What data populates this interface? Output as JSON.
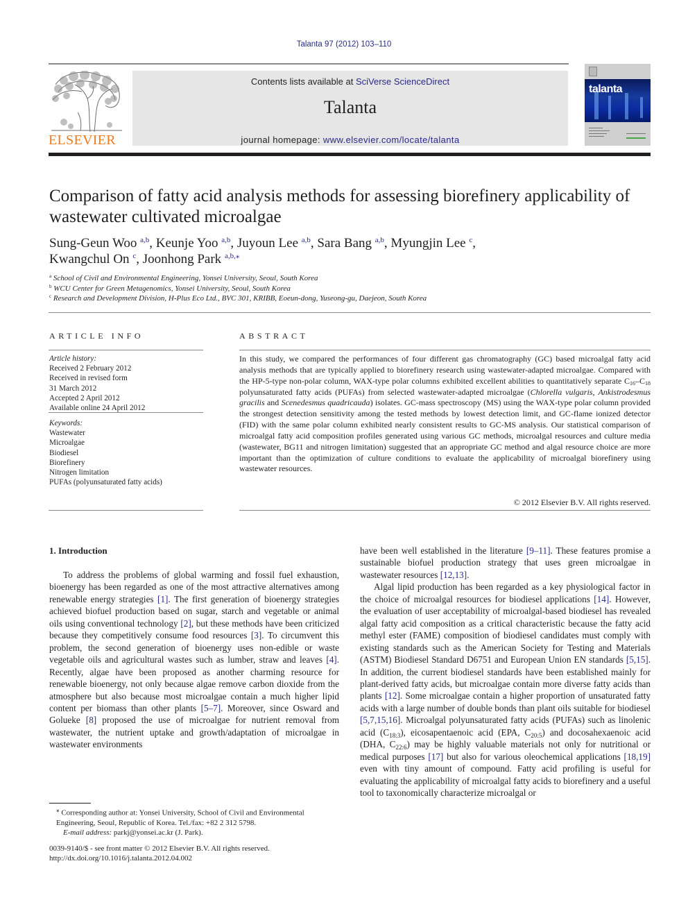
{
  "journal_ref": "Talanta 97 (2012) 103–110",
  "masthead": {
    "contents_prefix": "Contents lists available at ",
    "contents_link": "SciVerse ScienceDirect",
    "journal_title": "Talanta",
    "homepage_prefix": "journal homepage: ",
    "homepage_link": "www.elsevier.com/locate/talanta",
    "publisher_logo_text": "ELSEVIER",
    "cover_title": "talanta"
  },
  "colors": {
    "link": "#2a2a8a",
    "elsevier_orange": "#f07a1a",
    "masthead_bg": "#e6e6e6"
  },
  "article": {
    "title": "Comparison of fatty acid analysis methods for assessing biorefinery applicability of wastewater cultivated microalgae",
    "authors": [
      {
        "name": "Sung-Geun Woo",
        "aff": "a,b",
        "sep": ", "
      },
      {
        "name": "Keunje Yoo",
        "aff": "a,b",
        "sep": ", "
      },
      {
        "name": "Juyoun Lee",
        "aff": "a,b",
        "sep": ", "
      },
      {
        "name": "Sara Bang",
        "aff": "a,b",
        "sep": ", "
      },
      {
        "name": "Myungjin Lee",
        "aff": "c",
        "sep": ","
      },
      {
        "name": "Kwangchul On",
        "aff": "c",
        "sep": ", "
      },
      {
        "name": "Joonhong Park",
        "aff": "a,b,⁎",
        "sep": ""
      }
    ],
    "affiliations": [
      {
        "key": "a",
        "text": "School of Civil and Environmental Engineering, Yonsei University, Seoul, South Korea"
      },
      {
        "key": "b",
        "text": "WCU Center for Green Metagenomics, Yonsei University, Seoul, South Korea"
      },
      {
        "key": "c",
        "text": "Research and Development Division, H-Plus Eco Ltd., BVC 301, KRIBB, Eoeun-dong, Yuseong-gu, Daejeon, South Korea"
      }
    ]
  },
  "article_info": {
    "heading": "ARTICLE INFO",
    "history_label": "Article history:",
    "history": [
      "Received 2 February 2012",
      "Received in revised form",
      "31 March 2012",
      "Accepted 2 April 2012",
      "Available online 24 April 2012"
    ],
    "keywords_label": "Keywords:",
    "keywords": [
      "Wastewater",
      "Microalgae",
      "Biodiesel",
      "Biorefinery",
      "Nitrogen limitation",
      "PUFAs (polyunsaturated fatty acids)"
    ]
  },
  "abstract": {
    "heading": "ABSTRACT",
    "parts": {
      "p1": "In this study, we compared the performances of four different gas chromatography (GC) based microalgal fatty acid analysis methods that are typically applied to biorefinery research using wastewater-adapted microalgae. Compared with the HP-5-type non-polar column, WAX-type polar columns exhibited excellent abilities to quantitatively separate C",
      "sub1": "16",
      "p2": "–C",
      "sub2": "18",
      "p3": " polyunsaturated fatty acids (PUFAs) from selected wastewater-adapted microalgae (",
      "sp1": "Chlorella vulgaris",
      "p4": ", ",
      "sp2": "Ankistrodesmus gracilis",
      "p5": " and ",
      "sp3": "Scenedesmus quadricauda",
      "p6": ") isolates. GC-mass spectroscopy (MS) using the WAX-type polar column provided the strongest detection sensitivity among the tested methods by lowest detection limit, and GC-flame ionized detector (FID) with the same polar column exhibited nearly consistent results to GC-MS analysis. Our statistical comparison of microalgal fatty acid composition profiles generated using various GC methods, microalgal resources and culture media (wastewater, BG11 and nitrogen limitation) suggested that an appropriate GC method and algal resource choice are more important than the optimization of culture conditions to evaluate the applicability of microalgal biorefinery using wastewater resources."
    },
    "copyright": "© 2012 Elsevier B.V. All rights reserved."
  },
  "body": {
    "section_heading": "1.   Introduction",
    "left": {
      "t1": "To address the problems of global warming and fossil fuel exhaustion, bioenergy has been regarded as one of the most attractive alternatives among renewable energy strategies ",
      "c1": "[1]",
      "t2": ". The first generation of bioenergy strategies achieved biofuel production based on sugar, starch and vegetable or animal oils using conventional technology ",
      "c2": "[2]",
      "t3": ", but these methods have been criticized because they competitively consume food resources ",
      "c3": "[3]",
      "t4": ". To circumvent this problem, the second generation of bioenergy uses non-edible or waste vegetable oils and agricultural wastes such as lumber, straw and leaves ",
      "c4": "[4]",
      "t5": ". Recently, algae have been proposed as another charming resource for renewable bioenergy, not only because algae remove carbon dioxide from the atmosphere but also because most microalgae contain a much higher lipid content per biomass than other plants ",
      "c5": "[5–7]",
      "t6": ". Moreover, since Osward and Golueke ",
      "c6": "[8]",
      "t7": " proposed the use of microalgae for nutrient removal from wastewater, the nutrient uptake and growth/adaptation of microalgae in wastewater environments"
    },
    "right": {
      "t1": "have been well established in the literature ",
      "c1": "[9–11]",
      "t2": ". These features promise a sustainable biofuel production strategy that uses green microalgae in wastewater resources ",
      "c2": "[12,13]",
      "t3": ".",
      "p2_t1": "Algal lipid production has been regarded as a key physiological factor in the choice of microalgal resources for biodiesel applications ",
      "p2_c1": "[14]",
      "p2_t2": ". However, the evaluation of user acceptability of microalgal-based biodiesel has revealed algal fatty acid composition as a critical characteristic because the fatty acid methyl ester (FAME) composition of biodiesel candidates must comply with existing standards such as the American Society for Testing and Materials (ASTM) Biodiesel Standard D6751 and European Union EN standards ",
      "p2_c2": "[5,15]",
      "p2_t3": ". In addition, the current biodiesel standards have been established mainly for plant-derived fatty acids, but microalgae contain more diverse fatty acids than plants ",
      "p2_c3": "[12]",
      "p2_t4": ". Some microalgae contain a higher proportion of unsaturated fatty acids with a large number of double bonds than plant oils suitable for biodiesel ",
      "p2_c4": "[5,7,15,16]",
      "p2_t5": ". Microalgal polyunsaturated fatty acids (PUFAs) such as linolenic acid (C",
      "p2_s1": "18:3",
      "p2_t6": "), eicosapentaenoic acid (EPA, C",
      "p2_s2": "20:5",
      "p2_t7": ") and docosahexaenoic acid (DHA, C",
      "p2_s3": "22:6",
      "p2_t8": ") may be highly valuable materials not only for nutritional or medical purposes ",
      "p2_c5": "[17]",
      "p2_t9": " but also for various oleochemical applications ",
      "p2_c6": "[18,19]",
      "p2_t10": " even with tiny amount of compound. Fatty acid profiling is useful for evaluating the applicability of microalgal fatty acids to biorefinery and a useful tool to taxonomically characterize microalgal or"
    }
  },
  "footnote": {
    "marker": "⁎",
    "corresponding": " Corresponding author at: Yonsei University, School of Civil and Environmental Engineering, Seoul, Republic of Korea. Tel./fax: +82 2 312 5798.",
    "email_label": "E-mail address:",
    "email": " parkj@yonsei.ac.kr (J. Park).",
    "issn_line": "0039-9140/$ - see front matter © 2012 Elsevier B.V. All rights reserved.",
    "doi": "http://dx.doi.org/10.1016/j.talanta.2012.04.002"
  }
}
